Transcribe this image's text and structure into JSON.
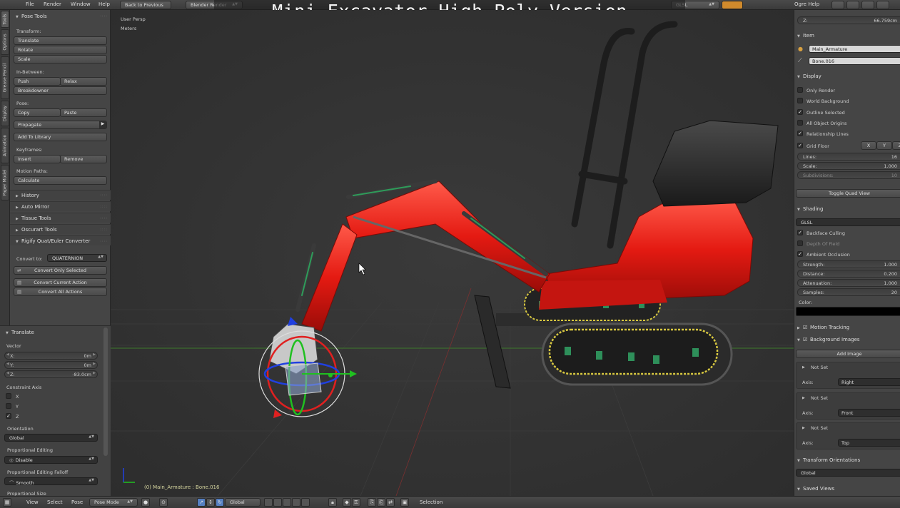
{
  "video_title": "Mini Excavator High Poly Version",
  "top_header": {
    "menus": [
      "File",
      "Render",
      "Window",
      "Help"
    ],
    "screen_button": "Back to Previous",
    "render_engine": "Blender Render",
    "shading_mode": "GLSL",
    "right_menu": "Ogre Help"
  },
  "left_tabs": [
    "Tools",
    "Options",
    "Grease Pencil",
    "Display",
    "Animation",
    "Paper Model"
  ],
  "tool_shelf": {
    "title": "Pose Tools",
    "transform_label": "Transform:",
    "translate": "Translate",
    "rotate": "Rotate",
    "scale": "Scale",
    "in_between_label": "In-Between:",
    "push": "Push",
    "relax": "Relax",
    "breakdowner": "Breakdowner",
    "pose_label": "Pose:",
    "copy": "Copy",
    "paste": "Paste",
    "propagate": "Propagate",
    "add_to_library": "Add To Library",
    "keyframes_label": "Keyframes:",
    "insert": "Insert",
    "remove": "Remove",
    "motion_paths_label": "Motion Paths:",
    "calculate": "Calculate",
    "collapsed_panels": [
      "History",
      "Auto Mirror",
      "Tissue Tools",
      "Oscurart Tools"
    ],
    "rigify_title": "Rigify Quat/Euler Converter",
    "convert_to_label": "Convert to:",
    "convert_to_value": "QUATERNION",
    "convert_only_selected": "Convert Only Selected",
    "convert_current_action": "Convert Current Action",
    "convert_all_actions": "Convert All Actions"
  },
  "operator_panel": {
    "title": "Translate",
    "vector_label": "Vector",
    "x_label": "X:",
    "x_value": "0m",
    "y_label": "Y:",
    "y_value": "0m",
    "z_label": "Z:",
    "z_value": "-83.0cm",
    "constraint_label": "Constraint Axis",
    "constraint_axes": [
      {
        "label": "X",
        "checked": false
      },
      {
        "label": "Y",
        "checked": false
      },
      {
        "label": "Z",
        "checked": true
      }
    ],
    "orientation_label": "Orientation",
    "orientation_value": "Global",
    "proportional_label": "Proportional Editing",
    "proportional_value": "Disable",
    "falloff_label": "Proportional Editing Falloff",
    "falloff_value": "Smooth",
    "size_label": "Proportional Size"
  },
  "viewport": {
    "view_name": "User Persp",
    "units": "Meters",
    "status": "(0) Main_Armature : Bone.016"
  },
  "right_panel": {
    "z_label": "Z:",
    "z_value": "66.759cm",
    "item_title": "Item",
    "object_name": "Main_Armature",
    "bone_name": "Bone.016",
    "display_title": "Display",
    "display_options": [
      {
        "label": "Only Render",
        "checked": false
      },
      {
        "label": "World Background",
        "checked": false
      },
      {
        "label": "Outline Selected",
        "checked": true
      },
      {
        "label": "All Object Origins",
        "checked": false
      },
      {
        "label": "Relationship Lines",
        "checked": true
      },
      {
        "label": "Grid Floor",
        "checked": true
      }
    ],
    "grid_axes": [
      "X",
      "Y",
      "Z"
    ],
    "lines_label": "Lines:",
    "lines_value": "16",
    "scale_label": "Scale:",
    "scale_value": "1.000",
    "subdivisions_label": "Subdivisions:",
    "subdivisions_value": "10",
    "toggle_quad_view": "Toggle Quad View",
    "shading_title": "Shading",
    "shading_value": "GLSL",
    "shading_options": [
      {
        "label": "Backface Culling",
        "checked": true,
        "dim": false
      },
      {
        "label": "Depth Of Field",
        "checked": false,
        "dim": true
      },
      {
        "label": "Ambient Occlusion",
        "checked": true,
        "dim": false
      }
    ],
    "strength_label": "Strength:",
    "strength_value": "1.000",
    "distance_label": "Distance:",
    "distance_value": "0.200",
    "attenuation_label": "Attenuation:",
    "attenuation_value": "1.000",
    "samples_label": "Samples:",
    "samples_value": "20",
    "color_label": "Color:",
    "motion_tracking": "Motion Tracking",
    "background_images": "Background Images",
    "add_image": "Add Image",
    "bg_slots": [
      {
        "name": "Not Set",
        "axis_label": "Axis:",
        "axis": "Right"
      },
      {
        "name": "Not Set",
        "axis_label": "Axis:",
        "axis": "Front"
      },
      {
        "name": "Not Set",
        "axis_label": "Axis:",
        "axis": "Top"
      }
    ],
    "transform_orientations": "Transform Orientations",
    "orientation_value": "Global",
    "saved_views": "Saved Views"
  },
  "bottom_header": {
    "menus": [
      "View",
      "Select",
      "Pose"
    ],
    "mode": "Pose Mode",
    "orientation": "Global",
    "selection": "Selection"
  },
  "colors": {
    "excavator_red": "#e41a12",
    "panel_bg": "#454545",
    "viewport_bg": "#333333",
    "status_text": "#d6d6a0",
    "manip_x": "#e02020",
    "manip_y": "#20c020",
    "manip_z": "#2040e0"
  }
}
